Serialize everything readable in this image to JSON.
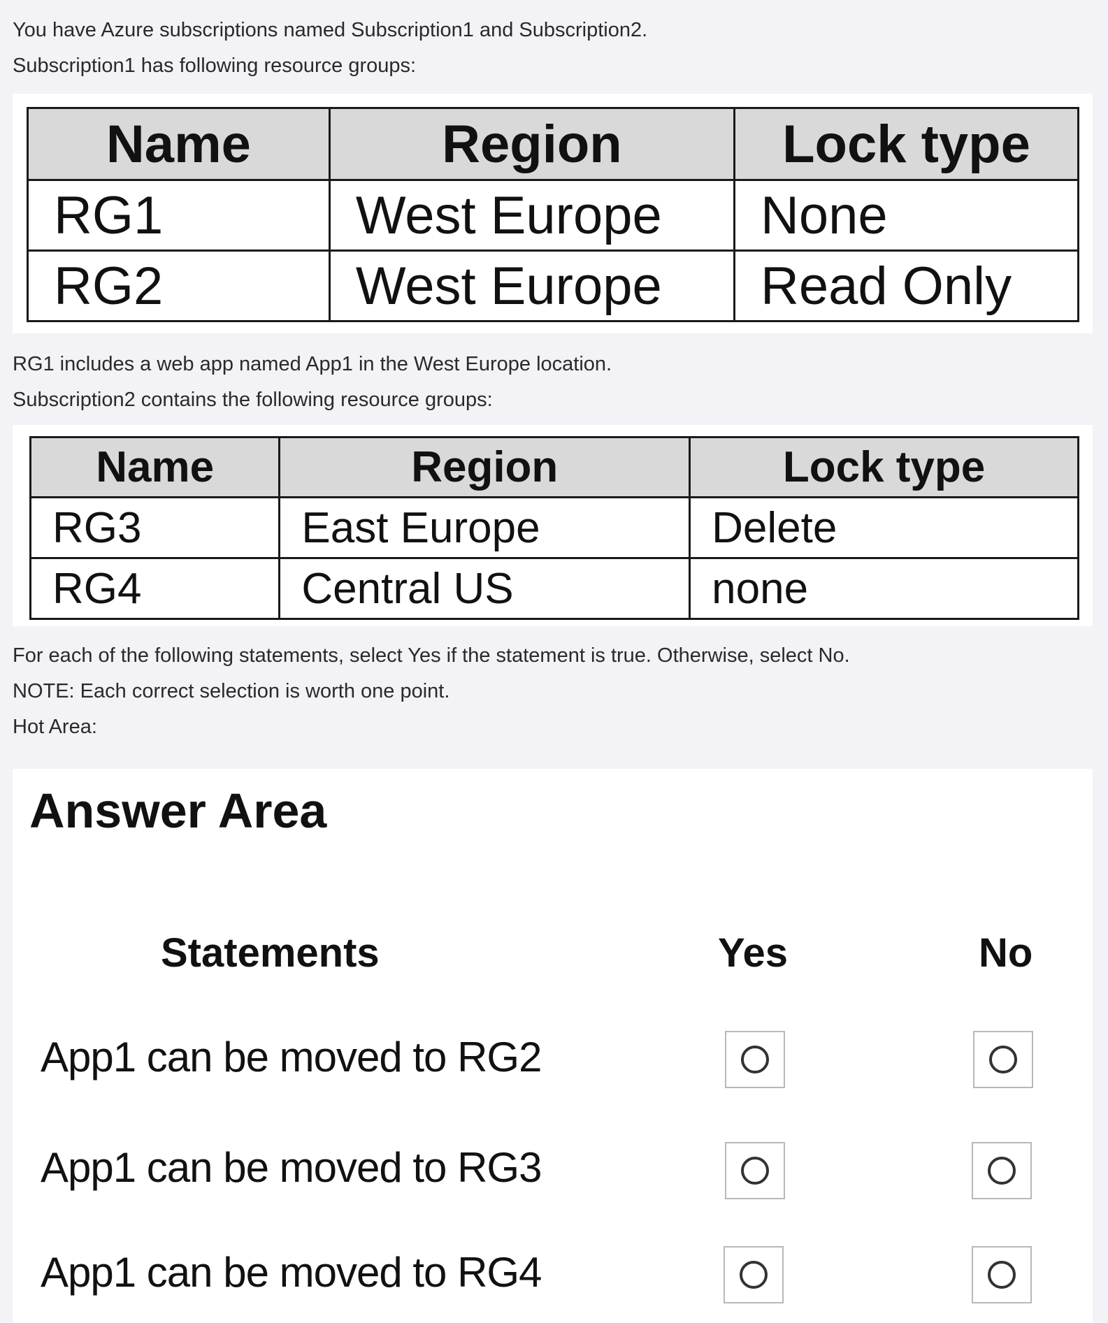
{
  "intro": {
    "line1": "You have Azure subscriptions named Subscription1 and Subscription2.",
    "line2": "Subscription1 has following resource groups:"
  },
  "table1": {
    "headers": [
      "Name",
      "Region",
      "Lock type"
    ],
    "rows": [
      [
        "RG1",
        "West Europe",
        "None"
      ],
      [
        "RG2",
        "West Europe",
        "Read Only"
      ]
    ]
  },
  "middle": {
    "line1": "RG1 includes a web app named App1 in the West Europe location.",
    "line2": "Subscription2 contains the following resource groups:"
  },
  "table2": {
    "headers": [
      "Name",
      "Region",
      "Lock type"
    ],
    "rows": [
      [
        "RG3",
        "East Europe",
        "Delete"
      ],
      [
        "RG4",
        "Central US",
        "none"
      ]
    ]
  },
  "instructions": {
    "line1": "For each of the following statements, select Yes if the statement is true. Otherwise, select No.",
    "line2": "NOTE: Each correct selection is worth one point.",
    "line3": "Hot Area:"
  },
  "answer_area": {
    "title": "Answer Area",
    "col_statements": "Statements",
    "col_yes": "Yes",
    "col_no": "No",
    "statements": [
      "App1 can be moved to RG2",
      "App1 can be moved to RG3",
      "App1 can be moved to RG4"
    ]
  }
}
